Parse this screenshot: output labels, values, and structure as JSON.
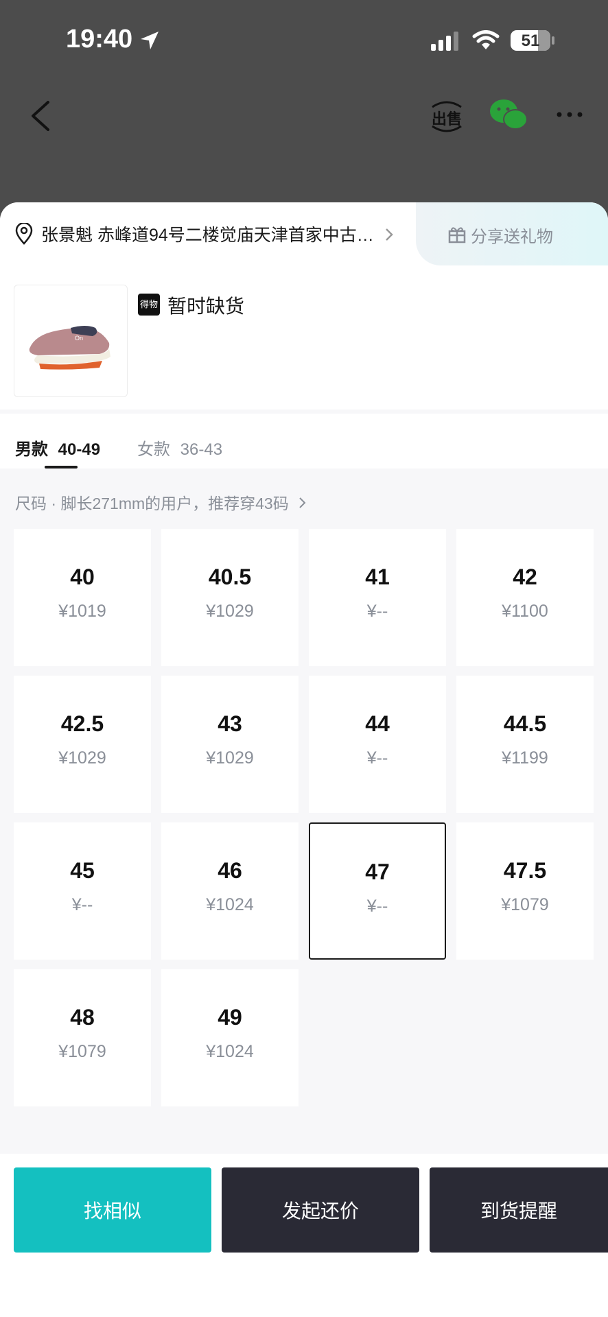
{
  "status_bar": {
    "time": "19:40",
    "battery": "51"
  },
  "nav": {
    "sell_label": "出售"
  },
  "address": {
    "text": "张景魁 赤峰道94号二楼觉庙天津首家中古…"
  },
  "gift": {
    "label": "分享送礼物"
  },
  "product": {
    "badge": "得物",
    "stock_status": "暂时缺货"
  },
  "tabs": [
    {
      "label": "男款",
      "range": "40-49",
      "active": true
    },
    {
      "label": "女款",
      "range": "36-43",
      "active": false
    }
  ],
  "size_hint": "尺码 · 脚长271mm的用户，推荐穿43码",
  "sizes": [
    {
      "size": "40",
      "price": "¥1019"
    },
    {
      "size": "40.5",
      "price": "¥1029"
    },
    {
      "size": "41",
      "price": "¥--"
    },
    {
      "size": "42",
      "price": "¥1100"
    },
    {
      "size": "42.5",
      "price": "¥1029"
    },
    {
      "size": "43",
      "price": "¥1029"
    },
    {
      "size": "44",
      "price": "¥--"
    },
    {
      "size": "44.5",
      "price": "¥1199"
    },
    {
      "size": "45",
      "price": "¥--"
    },
    {
      "size": "46",
      "price": "¥1024"
    },
    {
      "size": "47",
      "price": "¥--",
      "selected": true
    },
    {
      "size": "47.5",
      "price": "¥1079"
    },
    {
      "size": "48",
      "price": "¥1079"
    },
    {
      "size": "49",
      "price": "¥1024"
    }
  ],
  "actions": {
    "similar": "找相似",
    "bargain": "发起还价",
    "notify": "到货提醒"
  },
  "colors": {
    "teal": "#14c0c0",
    "dark": "#2a2a35",
    "bg": "#f7f7f9"
  }
}
